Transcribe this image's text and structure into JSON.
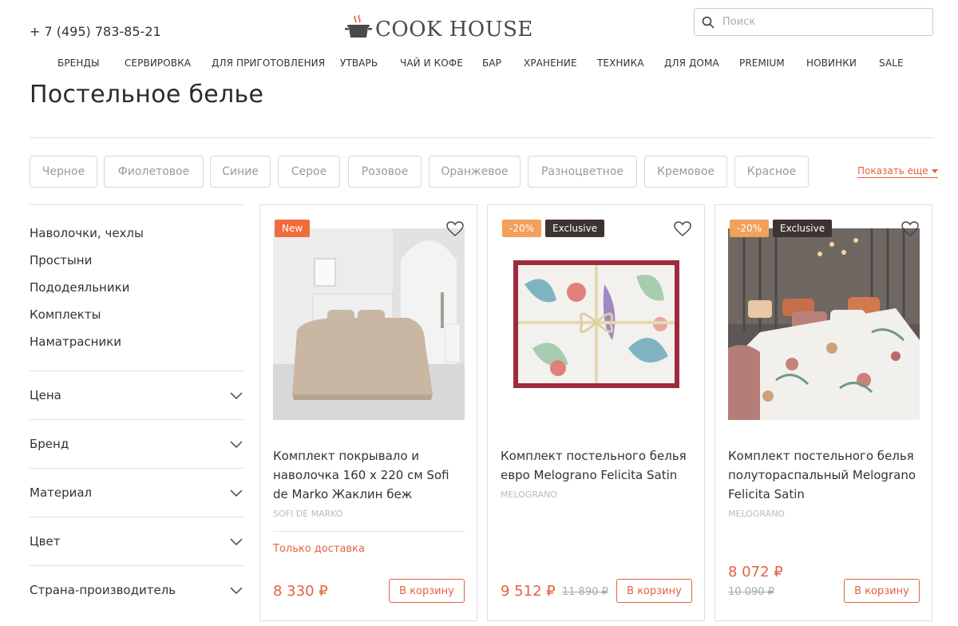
{
  "header": {
    "phone": "+ 7 (495) 783-85-21",
    "logo_text": "COOK HOUSE",
    "search_placeholder": "Поиск"
  },
  "nav": [
    {
      "label": "БРЕНДЫ",
      "accent": true
    },
    {
      "label": "СЕРВИРОВКА",
      "accent": false
    },
    {
      "label": "ДЛЯ ПРИГОТОВЛЕНИЯ",
      "accent": false
    },
    {
      "label": "УТВАРЬ",
      "accent": false
    },
    {
      "label": "ЧАЙ И КОФЕ",
      "accent": false
    },
    {
      "label": "БАР",
      "accent": false
    },
    {
      "label": "ХРАНЕНИЕ",
      "accent": false
    },
    {
      "label": "ТЕХНИКА",
      "accent": false
    },
    {
      "label": "ДЛЯ ДОМА",
      "accent": true
    },
    {
      "label": "PREMIUM",
      "accent": false
    },
    {
      "label": "НОВИНКИ",
      "accent": true
    },
    {
      "label": "SALE",
      "accent": true
    }
  ],
  "page": {
    "title": "Постельное белье"
  },
  "color_filters": [
    "Черное",
    "Фиолетовое",
    "Синие",
    "Серое",
    "Розовое",
    "Оранжевое",
    "Разноцветное",
    "Кремовое",
    "Красное"
  ],
  "show_more": "Показать еще",
  "sidebar": {
    "categories": [
      "Наволочки, чехлы",
      "Простыни",
      "Пододеяльники",
      "Комплекты",
      "Наматрасники"
    ],
    "filters": [
      "Цена",
      "Бренд",
      "Материал",
      "Цвет",
      "Страна-производитель"
    ]
  },
  "products": [
    {
      "badges": [
        {
          "label": "New",
          "kind": "new"
        }
      ],
      "name": "Комплект покрывало и наволочка 160 х 220 см Sofi de Marko Жаклин беж",
      "brand": "SOFI DE MARKO",
      "delivery": "Только доставка",
      "price": "8 330 ₽",
      "old_price": "",
      "cart_label": "В корзину"
    },
    {
      "badges": [
        {
          "label": "-20%",
          "kind": "sale"
        },
        {
          "label": "Exclusive",
          "kind": "exclusive"
        }
      ],
      "name": "Комплект постельного белья евро Melograno Felicita Satin",
      "brand": "MELOGRANO",
      "delivery": "",
      "price": "9 512 ₽",
      "old_price": "11 890 ₽",
      "cart_label": "В корзину"
    },
    {
      "badges": [
        {
          "label": "-20%",
          "kind": "sale"
        },
        {
          "label": "Exclusive",
          "kind": "exclusive"
        }
      ],
      "name": "Комплект постельного белья полутораспальный Melograno Felicita Satin",
      "brand": "MELOGRANO",
      "delivery": "",
      "price": "8 072 ₽",
      "old_price": "10 090 ₽",
      "cart_label": "В корзину"
    }
  ],
  "colors": {
    "accent": "#e3623f",
    "badge_new": "#f26b3a",
    "badge_sale": "#f2a05a",
    "badge_exclusive": "#3d3330"
  },
  "icons": {
    "search": "search-icon",
    "logo": "cooking-pot-icon",
    "favorite": "heart-icon",
    "expand": "chevron-down-icon"
  }
}
